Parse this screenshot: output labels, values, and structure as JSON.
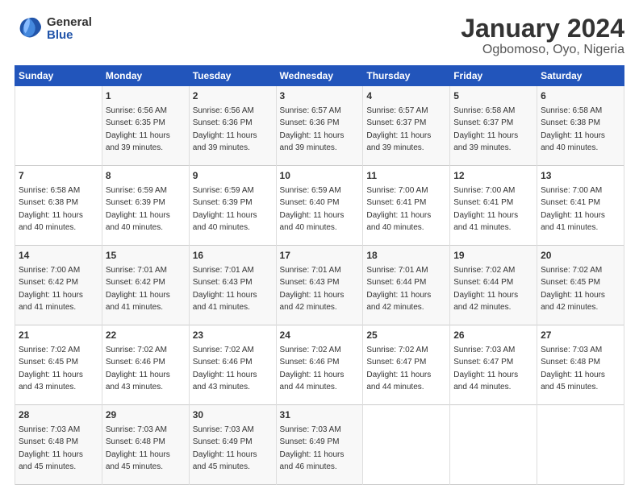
{
  "logo": {
    "general": "General",
    "blue": "Blue"
  },
  "title": "January 2024",
  "subtitle": "Ogbomoso, Oyo, Nigeria",
  "days_header": [
    "Sunday",
    "Monday",
    "Tuesday",
    "Wednesday",
    "Thursday",
    "Friday",
    "Saturday"
  ],
  "weeks": [
    [
      {
        "day": "",
        "info": ""
      },
      {
        "day": "1",
        "info": "Sunrise: 6:56 AM\nSunset: 6:35 PM\nDaylight: 11 hours and 39 minutes."
      },
      {
        "day": "2",
        "info": "Sunrise: 6:56 AM\nSunset: 6:36 PM\nDaylight: 11 hours and 39 minutes."
      },
      {
        "day": "3",
        "info": "Sunrise: 6:57 AM\nSunset: 6:36 PM\nDaylight: 11 hours and 39 minutes."
      },
      {
        "day": "4",
        "info": "Sunrise: 6:57 AM\nSunset: 6:37 PM\nDaylight: 11 hours and 39 minutes."
      },
      {
        "day": "5",
        "info": "Sunrise: 6:58 AM\nSunset: 6:37 PM\nDaylight: 11 hours and 39 minutes."
      },
      {
        "day": "6",
        "info": "Sunrise: 6:58 AM\nSunset: 6:38 PM\nDaylight: 11 hours and 40 minutes."
      }
    ],
    [
      {
        "day": "7",
        "info": "Sunrise: 6:58 AM\nSunset: 6:38 PM\nDaylight: 11 hours and 40 minutes."
      },
      {
        "day": "8",
        "info": "Sunrise: 6:59 AM\nSunset: 6:39 PM\nDaylight: 11 hours and 40 minutes."
      },
      {
        "day": "9",
        "info": "Sunrise: 6:59 AM\nSunset: 6:39 PM\nDaylight: 11 hours and 40 minutes."
      },
      {
        "day": "10",
        "info": "Sunrise: 6:59 AM\nSunset: 6:40 PM\nDaylight: 11 hours and 40 minutes."
      },
      {
        "day": "11",
        "info": "Sunrise: 7:00 AM\nSunset: 6:41 PM\nDaylight: 11 hours and 40 minutes."
      },
      {
        "day": "12",
        "info": "Sunrise: 7:00 AM\nSunset: 6:41 PM\nDaylight: 11 hours and 41 minutes."
      },
      {
        "day": "13",
        "info": "Sunrise: 7:00 AM\nSunset: 6:41 PM\nDaylight: 11 hours and 41 minutes."
      }
    ],
    [
      {
        "day": "14",
        "info": "Sunrise: 7:00 AM\nSunset: 6:42 PM\nDaylight: 11 hours and 41 minutes."
      },
      {
        "day": "15",
        "info": "Sunrise: 7:01 AM\nSunset: 6:42 PM\nDaylight: 11 hours and 41 minutes."
      },
      {
        "day": "16",
        "info": "Sunrise: 7:01 AM\nSunset: 6:43 PM\nDaylight: 11 hours and 41 minutes."
      },
      {
        "day": "17",
        "info": "Sunrise: 7:01 AM\nSunset: 6:43 PM\nDaylight: 11 hours and 42 minutes."
      },
      {
        "day": "18",
        "info": "Sunrise: 7:01 AM\nSunset: 6:44 PM\nDaylight: 11 hours and 42 minutes."
      },
      {
        "day": "19",
        "info": "Sunrise: 7:02 AM\nSunset: 6:44 PM\nDaylight: 11 hours and 42 minutes."
      },
      {
        "day": "20",
        "info": "Sunrise: 7:02 AM\nSunset: 6:45 PM\nDaylight: 11 hours and 42 minutes."
      }
    ],
    [
      {
        "day": "21",
        "info": "Sunrise: 7:02 AM\nSunset: 6:45 PM\nDaylight: 11 hours and 43 minutes."
      },
      {
        "day": "22",
        "info": "Sunrise: 7:02 AM\nSunset: 6:46 PM\nDaylight: 11 hours and 43 minutes."
      },
      {
        "day": "23",
        "info": "Sunrise: 7:02 AM\nSunset: 6:46 PM\nDaylight: 11 hours and 43 minutes."
      },
      {
        "day": "24",
        "info": "Sunrise: 7:02 AM\nSunset: 6:46 PM\nDaylight: 11 hours and 44 minutes."
      },
      {
        "day": "25",
        "info": "Sunrise: 7:02 AM\nSunset: 6:47 PM\nDaylight: 11 hours and 44 minutes."
      },
      {
        "day": "26",
        "info": "Sunrise: 7:03 AM\nSunset: 6:47 PM\nDaylight: 11 hours and 44 minutes."
      },
      {
        "day": "27",
        "info": "Sunrise: 7:03 AM\nSunset: 6:48 PM\nDaylight: 11 hours and 45 minutes."
      }
    ],
    [
      {
        "day": "28",
        "info": "Sunrise: 7:03 AM\nSunset: 6:48 PM\nDaylight: 11 hours and 45 minutes."
      },
      {
        "day": "29",
        "info": "Sunrise: 7:03 AM\nSunset: 6:48 PM\nDaylight: 11 hours and 45 minutes."
      },
      {
        "day": "30",
        "info": "Sunrise: 7:03 AM\nSunset: 6:49 PM\nDaylight: 11 hours and 45 minutes."
      },
      {
        "day": "31",
        "info": "Sunrise: 7:03 AM\nSunset: 6:49 PM\nDaylight: 11 hours and 46 minutes."
      },
      {
        "day": "",
        "info": ""
      },
      {
        "day": "",
        "info": ""
      },
      {
        "day": "",
        "info": ""
      }
    ]
  ]
}
